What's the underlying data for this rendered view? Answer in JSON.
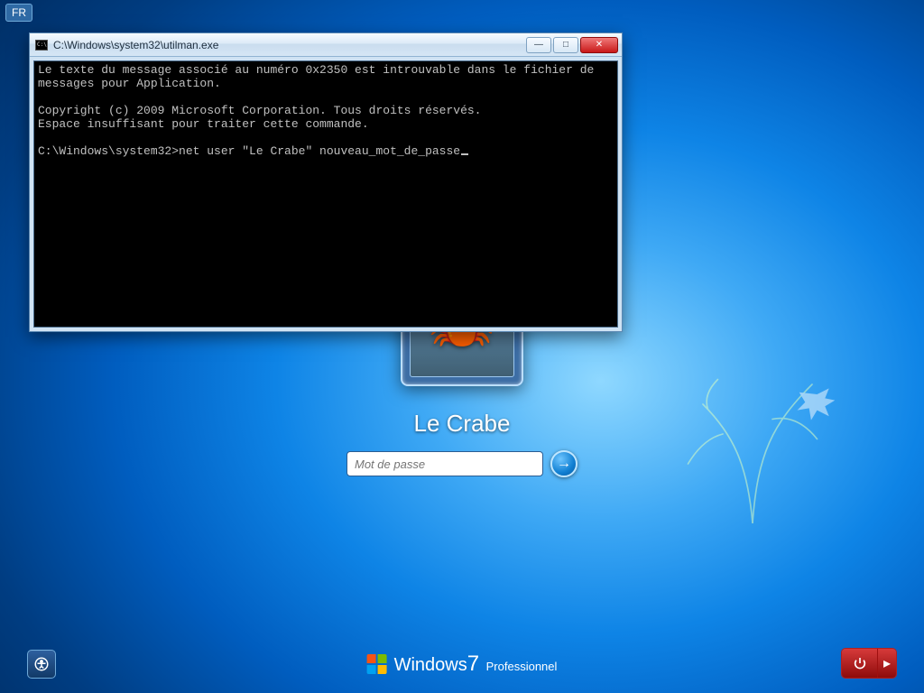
{
  "language_indicator": "FR",
  "login": {
    "username": "Le Crabe",
    "password_placeholder": "Mot de passe",
    "avatar_semantic": "crab"
  },
  "branding": {
    "product": "Windows",
    "version": "7",
    "edition": "Professionnel"
  },
  "ease_of_access_button": "Ease of Access",
  "power_button": "Shut down",
  "cmd": {
    "title": "C:\\Windows\\system32\\utilman.exe",
    "lines": [
      "Le texte du message associé au numéro 0x2350 est introuvable dans le fichier de",
      "messages pour Application.",
      "",
      "Copyright (c) 2009 Microsoft Corporation. Tous droits réservés.",
      "Espace insuffisant pour traiter cette commande.",
      "",
      "C:\\Windows\\system32>net user \"Le Crabe\" nouveau_mot_de_passe"
    ]
  }
}
